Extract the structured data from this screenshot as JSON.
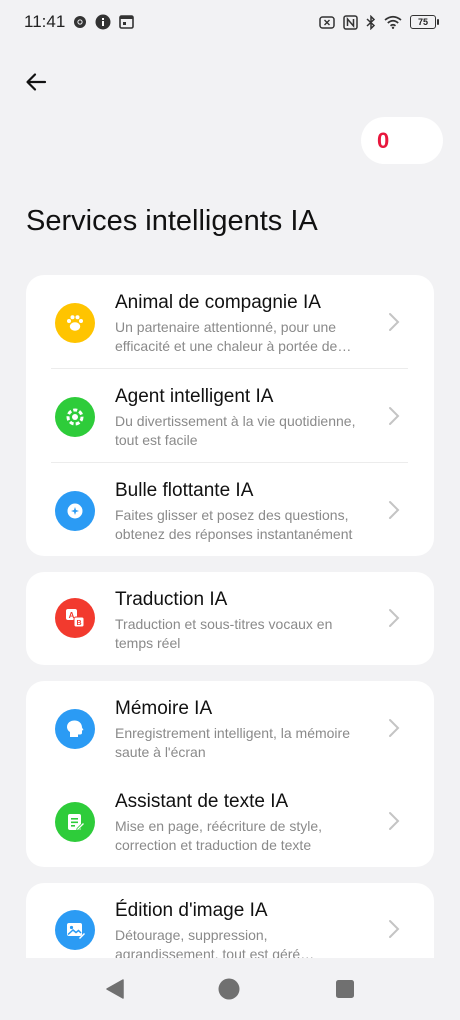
{
  "status_bar": {
    "time": "11:41",
    "battery": "75"
  },
  "counter": {
    "value": "0"
  },
  "page": {
    "title": "Services intelligents IA"
  },
  "items": [
    {
      "title": "Animal de compagnie IA",
      "desc": "Un partenaire attentionné, pour une efficacité et une chaleur à portée de main",
      "icon": "paw-icon",
      "color": "#ffc400"
    },
    {
      "title": "Agent intelligent IA",
      "desc": "Du divertissement à la vie quotidienne, tout est facile",
      "icon": "agent-icon",
      "color": "#2ecc3a"
    },
    {
      "title": "Bulle flottante IA",
      "desc": "Faites glisser et posez des questions, obtenez des réponses instantanément",
      "icon": "floating-bubble-icon",
      "color": "#2b9bf4"
    },
    {
      "title": "Traduction IA",
      "desc": "Traduction et sous-titres vocaux en temps réel",
      "icon": "translate-icon",
      "color": "#f23a2e"
    },
    {
      "title": "Mémoire IA",
      "desc": "Enregistrement intelligent, la mémoire saute à l'écran",
      "icon": "memory-head-icon",
      "color": "#2b9bf4"
    },
    {
      "title": "Assistant de texte IA",
      "desc": "Mise en page, réécriture de style, correction et traduction de texte",
      "icon": "text-assistant-icon",
      "color": "#2ecc3a"
    },
    {
      "title": "Édition d'image IA",
      "desc": "Détourage, suppression, agrandissement, tout est géré intelligemment",
      "icon": "image-edit-icon",
      "color": "#2b9bf4"
    }
  ]
}
